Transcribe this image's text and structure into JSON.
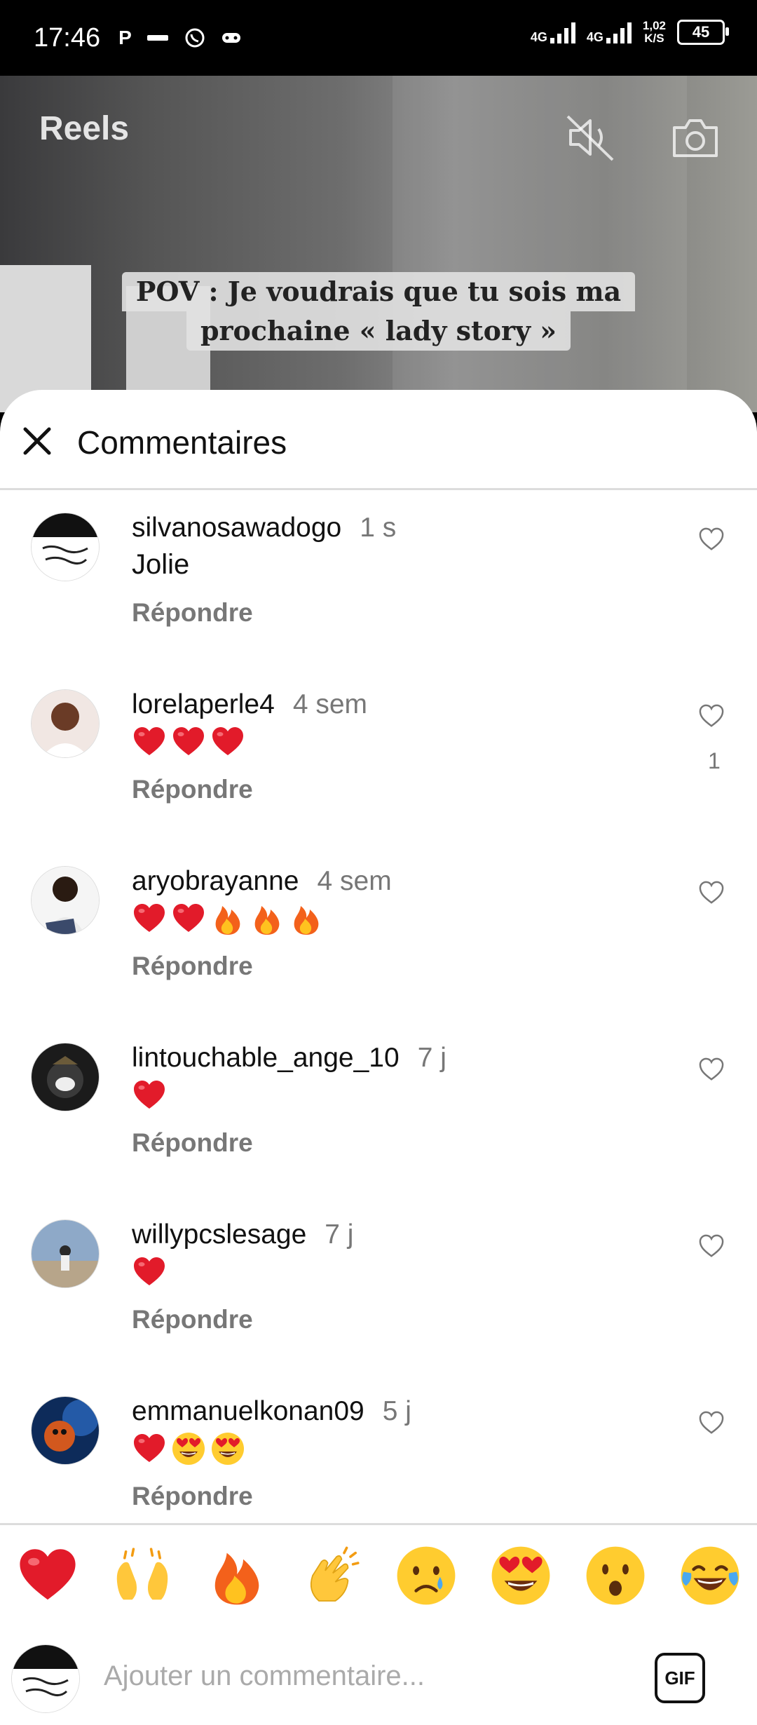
{
  "status_bar": {
    "time": "17:46",
    "left_icons": [
      "P",
      "orange",
      "whatsapp-icon",
      "game-icon"
    ],
    "net1": "4G",
    "net2": "4G",
    "speed_value": "1,02",
    "speed_unit": "K/S",
    "battery": "45"
  },
  "video": {
    "title": "Reels",
    "caption_line1": "POV : Je voudrais que tu sois ma",
    "caption_line2": "prochaine « lady story »"
  },
  "sheet": {
    "title": "Commentaires"
  },
  "comments": [
    {
      "user": "silvanosawadogo",
      "time": "1 s",
      "text": "Jolie",
      "emojis": [],
      "reply": "Répondre",
      "likes": ""
    },
    {
      "user": "lorelaperle4",
      "time": "4 sem",
      "text": "",
      "emojis": [
        "heart",
        "heart",
        "heart"
      ],
      "reply": "Répondre",
      "likes": "1"
    },
    {
      "user": "aryobrayanne",
      "time": "4 sem",
      "text": "",
      "emojis": [
        "heart",
        "heart",
        "fire",
        "fire",
        "fire"
      ],
      "reply": "Répondre",
      "likes": ""
    },
    {
      "user": "lintouchable_ange_10",
      "time": "7 j",
      "text": "",
      "emojis": [
        "heart"
      ],
      "reply": "Répondre",
      "likes": ""
    },
    {
      "user": "willypcslesage",
      "time": "7 j",
      "text": "",
      "emojis": [
        "heart"
      ],
      "reply": "Répondre",
      "likes": ""
    },
    {
      "user": "emmanuelkonan09",
      "time": "5 j",
      "text": "",
      "emojis": [
        "heart",
        "heart-eyes",
        "heart-eyes"
      ],
      "reply": "Répondre",
      "likes": ""
    }
  ],
  "reactions": [
    "heart",
    "raising-hands",
    "fire",
    "clapping-hands",
    "crying-face",
    "heart-eyes",
    "surprised-face",
    "tears-of-joy"
  ],
  "composer": {
    "placeholder": "Ajouter un commentaire...",
    "gif_label": "GIF"
  }
}
